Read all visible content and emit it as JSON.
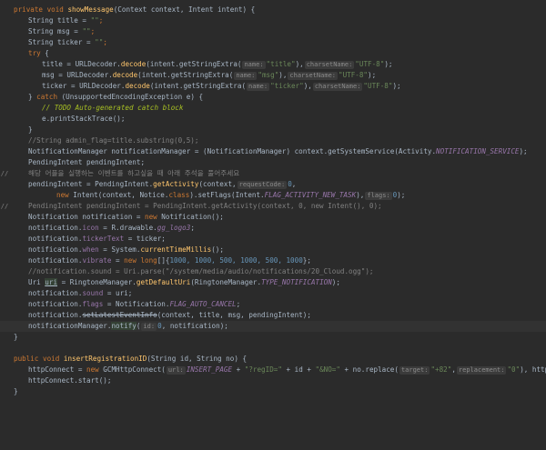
{
  "code": {
    "l1_a": "private void ",
    "l1_b": "showMessage",
    "l1_c": "(Context context, Intent intent) {",
    "l2_a": "String title = ",
    "l2_b": "\"\"",
    "l2_c": ";",
    "l3_a": "String msg = ",
    "l3_b": "\"\"",
    "l3_c": ";",
    "l4_a": "String ticker = ",
    "l4_b": "\"\"",
    "l4_c": ";",
    "l5_a": "try",
    "l5_b": " {",
    "l6_a": "title = URLDecoder.",
    "l6_b": "decode",
    "l6_c": "(intent.getStringExtra(",
    "l6_h1": "name:",
    "l6_s1": "\"title\"",
    "l6_d": "),",
    "l6_h2": "charsetName:",
    "l6_s2": "\"UTF-8\"",
    "l6_e": ");",
    "l7_a": "msg = URLDecoder.",
    "l7_b": "decode",
    "l7_c": "(intent.getStringExtra(",
    "l7_h1": "name:",
    "l7_s1": "\"msg\"",
    "l7_d": "),",
    "l7_h2": "charsetName:",
    "l7_s2": "\"UTF-8\"",
    "l7_e": ");",
    "l8_a": "ticker = URLDecoder.",
    "l8_b": "decode",
    "l8_c": "(intent.getStringExtra(",
    "l8_h1": "name:",
    "l8_s1": "\"ticker\"",
    "l8_d": "),",
    "l8_h2": "charsetName:",
    "l8_s2": "\"UTF-8\"",
    "l8_e": ");",
    "l9_a": "} ",
    "l9_b": "catch",
    "l9_c": " (UnsupportedEncodingException e) {",
    "l10": "// TODO Auto-generated catch block",
    "l11": "e.printStackTrace();",
    "l12": "}",
    "l13": "//String admin_flag=title.substring(0,5);",
    "l14_a": "NotificationManager notificationManager = (NotificationManager) context.getSystemService(Activity.",
    "l14_b": "NOTIFICATION_SERVICE",
    "l14_c": ");",
    "l15": "PendingIntent pendingIntent;",
    "l16_g": "//",
    "l16": "해당 어플을 실행하는 이벤트를 하고싶을 때 아래 주석을 풀어주세요",
    "l17_a": "pendingIntent = PendingIntent.",
    "l17_b": "getActivity",
    "l17_c": "(context,",
    "l17_h": "requestCode:",
    "l17_n": "0",
    "l17_d": ",",
    "l18_a": "new ",
    "l18_b": "Intent(context, Notice.",
    "l18_c": "class",
    "l18_d": ").setFlags(Intent.",
    "l18_e": "FLAG_ACTIVITY_NEW_TASK",
    "l18_f": "),",
    "l18_h": "flags:",
    "l18_n": "0",
    "l18_g": ");",
    "l19_g": "//",
    "l19": "PendingIntent pendingIntent = PendingIntent.getActivity(context, 0, new Intent(), 0);",
    "l20_a": "Notification notification = ",
    "l20_b": "new",
    "l20_c": " Notification();",
    "l21_a": "notification.",
    "l21_b": "icon",
    "l21_c": " = R.drawable.",
    "l21_d": "gg_logo3",
    "l21_e": ";",
    "l22_a": "notification.",
    "l22_b": "tickerText",
    "l22_c": " = ticker;",
    "l23_a": "notification.",
    "l23_b": "when",
    "l23_c": " = System.",
    "l23_d": "currentTimeMillis",
    "l23_e": "();",
    "l24_a": "notification.",
    "l24_b": "vibrate",
    "l24_c": " = ",
    "l24_d": "new long",
    "l24_e": "[]{",
    "l24_f": "1000, 1000, 500, 1000, 500, 1000",
    "l24_g": "};",
    "l25": "//notification.sound = Uri.parse(\"/system/media/audio/notifications/20_Cloud.ogg\");",
    "l26_a": "Uri ",
    "l26_b": "uri",
    "l26_c": " = RingtoneManager.",
    "l26_d": "getDefaultUri",
    "l26_e": "(RingtoneManager.",
    "l26_f": "TYPE_NOTIFICATION",
    "l26_g": ");",
    "l27_a": "notification.",
    "l27_b": "sound",
    "l27_c": " = uri;",
    "l28_a": "notification.",
    "l28_b": "flags",
    "l28_c": " = Notification.",
    "l28_d": "FLAG_AUTO_CANCEL",
    "l28_e": ";",
    "l29_a": "notification.",
    "l29_b": "setLatestEventInfo",
    "l29_c": "(context, title, msg, pendingIntent);",
    "l30_a": "notificationManager.",
    "l30_b": "notify",
    "l30_c": "(",
    "l30_h": "id:",
    "l30_n": "0",
    "l30_d": ", notification);",
    "l31": "}",
    "l33_a": "public void ",
    "l33_b": "insertRegistrationID",
    "l33_c": "(String id, String no) {",
    "l34_a": "httpConnect = ",
    "l34_b": "new",
    "l34_c": " GCMHttpConnect(",
    "l34_h1": "url:",
    "l34_d": "INSERT_PAGE",
    "l34_e": " + ",
    "l34_s1": "\"?regID=\"",
    "l34_f": " + id + ",
    "l34_s2": "\"&NO=\"",
    "l34_g": " + no.replace(",
    "l34_h2": "target:",
    "l34_s3": "\"+82\"",
    "l34_i": ",",
    "l34_h3": "replacement:",
    "l34_s4": "\"0\"",
    "l34_j": "), httpRequest);",
    "l35": "httpConnect.start();",
    "l36": "}"
  }
}
